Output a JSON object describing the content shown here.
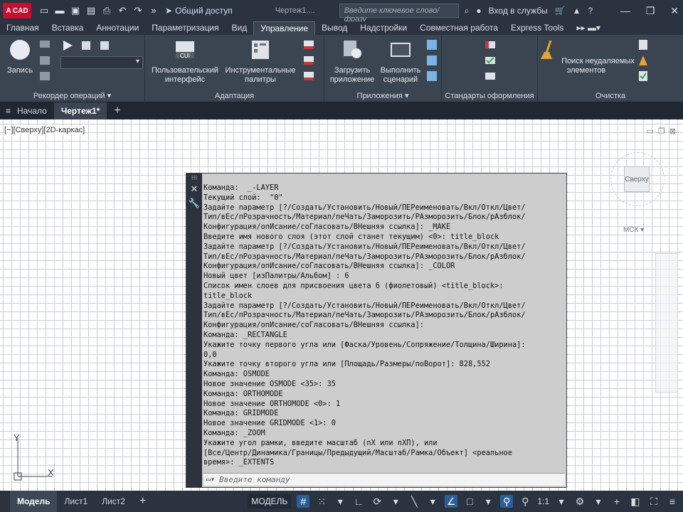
{
  "titlebar": {
    "logo_text": "A CAD",
    "share_label": "Общий доступ",
    "doc_title": "Чертеж1....",
    "search_placeholder": "Введите ключевое слово/фразу",
    "signin_label": "Вход в службы"
  },
  "ribbon_tabs": [
    "Главная",
    "Вставка",
    "Аннотации",
    "Параметризация",
    "Вид",
    "Управление",
    "Вывод",
    "Надстройки",
    "Совместная работа",
    "Express Tools"
  ],
  "active_tab": "Управление",
  "panels": {
    "recorder": {
      "title": "Рекордер операций",
      "record_label": "Запись"
    },
    "customization": {
      "title": "Адаптация",
      "ui_label": "Пользовательский интерфейс",
      "palettes_label": "Инструментальные палитры",
      "cui_text": "CUI"
    },
    "applications": {
      "title": "Приложения",
      "load_label": "Загрузить приложение",
      "run_label": "Выполнить сценарий"
    },
    "standards": {
      "title": "Стандарты оформления"
    },
    "cleanup": {
      "title": "Очистка",
      "find_label": "Поиск неудаляемых элементов"
    }
  },
  "doc_tabs": {
    "start": "Начало",
    "drawing": "Чертеж1*"
  },
  "viewport": {
    "label": "[−][Сверху][2D-каркас]",
    "viewcube_face": "Сверху",
    "ucs_label": "МСК",
    "axis_x": "X",
    "axis_y": "Y"
  },
  "command_window": {
    "lines": "Команда:  _-LAYER\nТекущий слой:  \"0\"\nЗадайте параметр [?/Создать/Установить/Новый/ПЕРеименовать/Вкл/Откл/Цвет/\nТип/вЕс/пРозрачность/Материал/пеЧать/Заморозить/РАзморозить/Блок/рАзблок/\nКонфигурация/опИсание/соГласовать/ВНешняя ссылка]: _MAKE\nВведите имя нового слоя (этот слой станет текущим) <0>: title_block\nЗадайте параметр [?/Создать/Установить/Новый/ПЕРеименовать/Вкл/Откл/Цвет/\nТип/вЕс/пРозрачность/Материал/пеЧать/Заморозить/РАзморозить/Блок/рАзблок/\nКонфигурация/опИсание/соГласовать/ВНешняя ссылка]: _COLOR\nНовый цвет [изПалитры/Альбом] : 6\nСписок имен слоев для присвоения цвета 6 (фиолетовый) <title_block>:\ntitle_block\nЗадайте параметр [?/Создать/Установить/Новый/ПЕРеименовать/Вкл/Откл/Цвет/\nТип/вЕс/пРозрачность/Материал/пеЧать/Заморозить/РАзморозить/Блок/рАзблок/\nКонфигурация/опИсание/соГласовать/ВНешняя ссылка]:\nКоманда: _RECTANGLE\nУкажите точку первого угла или [Фаска/Уровень/Сопряжение/Толщина/Ширина]:\n0,0\nУкажите точку второго угла или [Площадь/Размеры/поВорот]: 828,552\nКоманда: OSMODE\nНовое значение OSMODE <35>: 35\nКоманда: ORTHOMODE\nНовое значение ORTHOMODE <0>: 1\nКоманда: GRIDMODE\nНовое значение GRIDMODE <1>: 0\nКоманда: _ZOOM\nУкажите угол рамки, введите масштаб (nX или nXП), или\n[Все/Центр/Динамика/Границы/Предыдущий/Масштаб/Рамка/Объект] <реальное\nвремя>: _EXTENTS",
    "input_placeholder": "Введите команду"
  },
  "statusbar": {
    "tabs": [
      "Модель",
      "Лист1",
      "Лист2"
    ],
    "model_label": "МОДЕЛЬ",
    "scale_label": "1:1"
  }
}
